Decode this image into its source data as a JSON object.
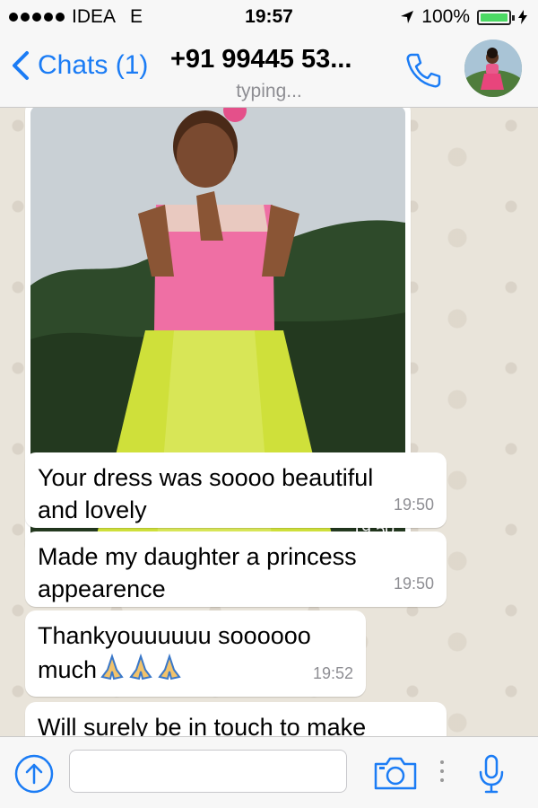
{
  "status_bar": {
    "carrier": "IDEA",
    "network": "E",
    "time": "19:57",
    "battery_percent": "100%",
    "battery_level": 1.0
  },
  "nav": {
    "back_label": "Chats (1)",
    "contact_name": "+91 99445 53...",
    "status": "typing...",
    "icons": {
      "back": "chevron-left-icon",
      "call": "phone-icon",
      "avatar": "contact-avatar"
    }
  },
  "messages": [
    {
      "type": "image",
      "time": "19:50"
    },
    {
      "type": "text",
      "lines": [
        "Your dress was soooo beautiful",
        "and lovely"
      ],
      "time": "19:50"
    },
    {
      "type": "text",
      "lines": [
        "Made my daughter a princess",
        "appearence"
      ],
      "time": "19:50"
    },
    {
      "type": "text",
      "lines": [
        "Thankyouuuuuu soooooo",
        "much"
      ],
      "emoji": [
        "folded-hands-icon",
        "folded-hands-icon",
        "folded-hands-icon"
      ],
      "time": "19:52"
    },
    {
      "type": "text",
      "lines": [
        "Will surely be in touch to make"
      ],
      "time": ""
    }
  ],
  "input_bar": {
    "placeholder": "",
    "icons": [
      "share-icon",
      "camera-icon",
      "more-icon",
      "mic-icon"
    ]
  },
  "colors": {
    "accent": "#1b7cf5",
    "bubble": "#ffffff",
    "background": "#e9e4da",
    "battery": "#4cd964"
  }
}
